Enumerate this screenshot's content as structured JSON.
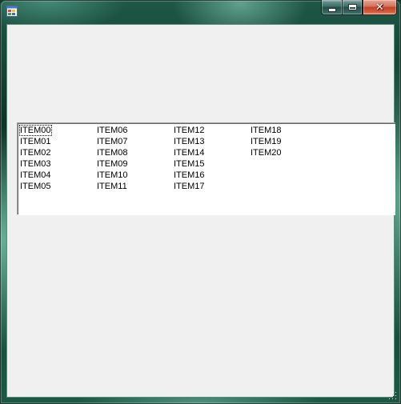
{
  "window": {
    "title": "",
    "icon": "app-window-icon"
  },
  "caption_buttons": {
    "minimize_icon": "minimize-icon",
    "maximize_icon": "maximize-icon",
    "close_icon": "close-icon"
  },
  "list_view": {
    "view_mode": "list",
    "columns": [
      [
        "ITEM00",
        "ITEM01",
        "ITEM02",
        "ITEM03",
        "ITEM04",
        "ITEM05"
      ],
      [
        "ITEM06",
        "ITEM07",
        "ITEM08",
        "ITEM09",
        "ITEM10",
        "ITEM11"
      ],
      [
        "ITEM12",
        "ITEM13",
        "ITEM14",
        "ITEM15",
        "ITEM16",
        "ITEM17"
      ],
      [
        "ITEM18",
        "ITEM19",
        "ITEM20"
      ]
    ],
    "focused_item": "ITEM00"
  },
  "colors": {
    "client_background": "#f0f0f0",
    "list_background": "#ffffff",
    "close_button": "#c24128"
  }
}
